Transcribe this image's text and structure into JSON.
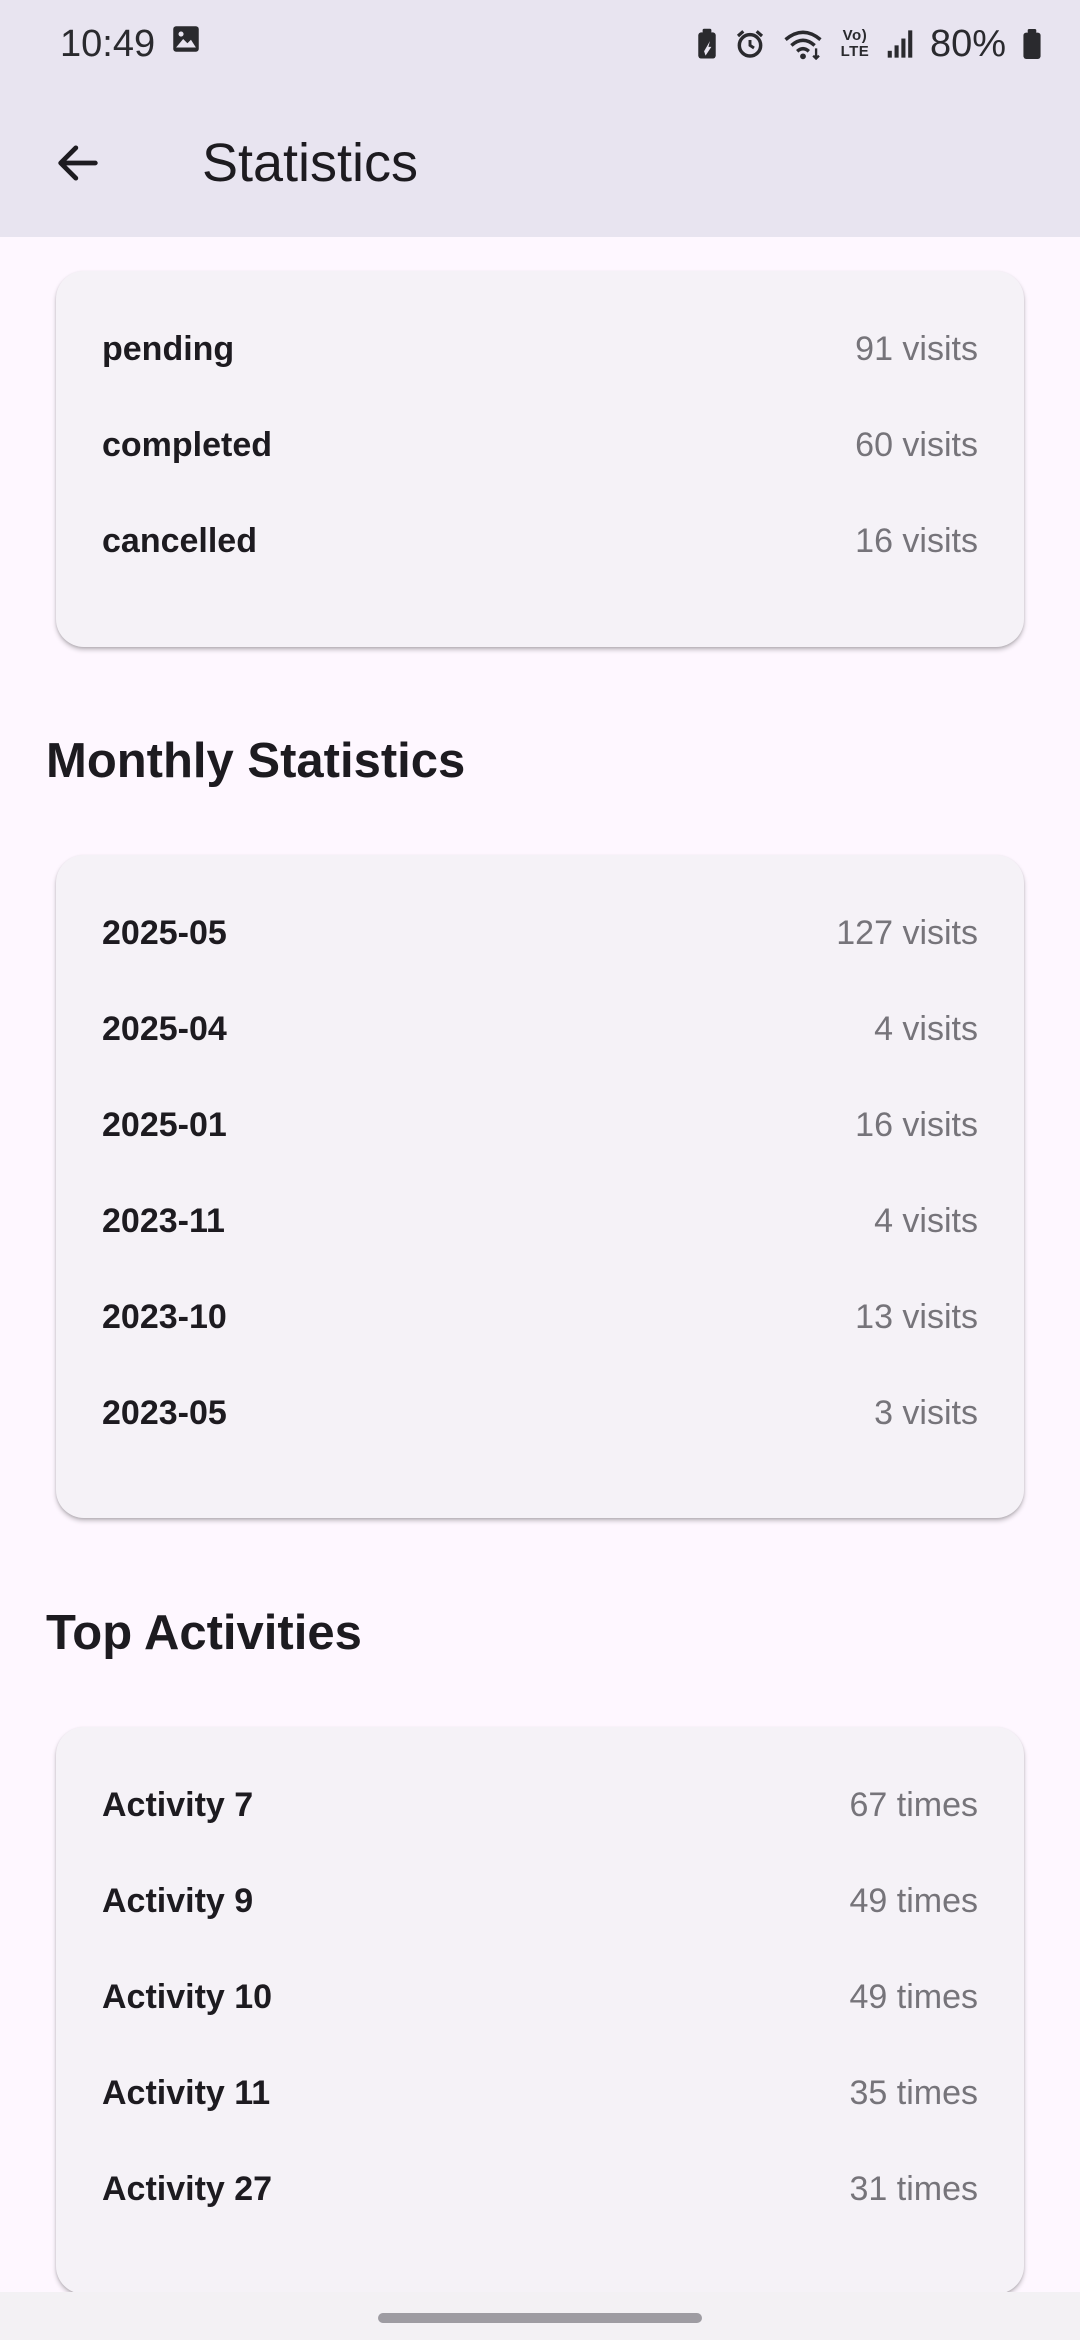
{
  "status_bar": {
    "time": "10:49",
    "battery": "80%",
    "network": "Vo) LTE"
  },
  "app_bar": {
    "title": "Statistics"
  },
  "status_card": {
    "rows": [
      {
        "label": "pending",
        "value": "91 visits"
      },
      {
        "label": "completed",
        "value": "60 visits"
      },
      {
        "label": "cancelled",
        "value": "16 visits"
      }
    ]
  },
  "monthly": {
    "heading": "Monthly Statistics",
    "rows": [
      {
        "label": "2025-05",
        "value": "127 visits"
      },
      {
        "label": "2025-04",
        "value": "4 visits"
      },
      {
        "label": "2025-01",
        "value": "16 visits"
      },
      {
        "label": "2023-11",
        "value": "4 visits"
      },
      {
        "label": "2023-10",
        "value": "13 visits"
      },
      {
        "label": "2023-05",
        "value": "3 visits"
      }
    ]
  },
  "activities": {
    "heading": "Top Activities",
    "rows": [
      {
        "label": "Activity 7",
        "value": "67 times"
      },
      {
        "label": "Activity 9",
        "value": "49 times"
      },
      {
        "label": "Activity 10",
        "value": "49 times"
      },
      {
        "label": "Activity 11",
        "value": "35 times"
      },
      {
        "label": "Activity 27",
        "value": "31 times"
      }
    ]
  },
  "icons": {
    "back": "arrow-back-icon",
    "gallery": "image-icon",
    "battery_saver": "battery-saver-icon",
    "alarm": "alarm-icon",
    "wifi": "wifi-icon",
    "signal": "signal-icon",
    "battery": "battery-icon"
  },
  "colors": {
    "app_bar_bg": "#e8e4f0",
    "page_bg": "#fef7ff",
    "card_bg": "#f5f2f7",
    "label_text": "#1d1b20",
    "value_text": "#76747a"
  }
}
